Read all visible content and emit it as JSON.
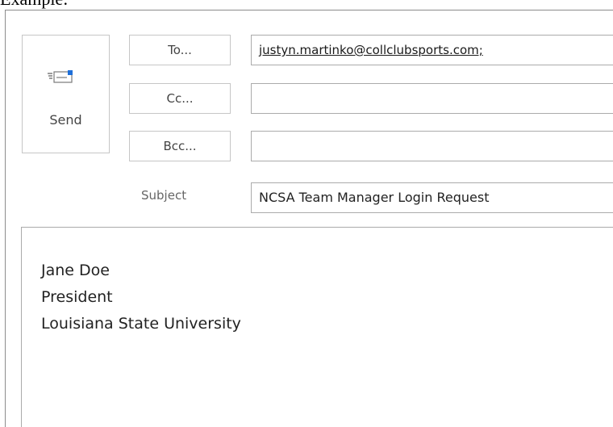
{
  "header": {
    "example_label": "Example:"
  },
  "compose": {
    "send_label": "Send",
    "send_icon": "send-envelope-icon",
    "to_label": "To...",
    "cc_label": "Cc...",
    "bcc_label": "Bcc...",
    "subject_label": "Subject",
    "to_value": "justyn.martinko@collclubsports.com;",
    "cc_value": "",
    "bcc_value": "",
    "subject_value": "NCSA Team Manager Login Request"
  },
  "body": {
    "lines": [
      "Jane Doe",
      "President",
      "Louisiana State University"
    ]
  },
  "colors": {
    "border": "#ababab",
    "button_border": "#c6c6c6",
    "icon_blue": "#1e6fd9"
  }
}
